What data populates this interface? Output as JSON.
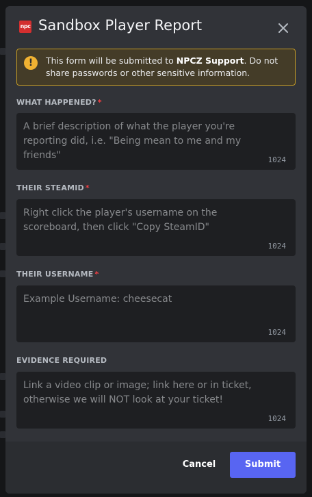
{
  "modal": {
    "app_icon_text": "npc",
    "title": "Sandbox Player Report",
    "close_icon": "close-icon"
  },
  "warning": {
    "icon": "warning-icon",
    "text_prefix": "This form will be submitted to ",
    "text_bold": "NPCZ Support",
    "text_suffix": ". Do not share passwords or other sensitive information."
  },
  "fields": [
    {
      "label": "WHAT HAPPENED?",
      "required": true,
      "required_mark": "*",
      "placeholder": "A brief description of what the player you're reporting did, i.e. \"Being mean to me and my friends\"",
      "value": "",
      "counter": "1024"
    },
    {
      "label": "THEIR STEAMID",
      "required": true,
      "required_mark": "*",
      "placeholder": "Right click the player's username on the scoreboard, then click \"Copy SteamID\"",
      "value": "",
      "counter": "1024"
    },
    {
      "label": "THEIR USERNAME",
      "required": true,
      "required_mark": "*",
      "placeholder": "Example Username: cheesecat",
      "value": "",
      "counter": "1024"
    },
    {
      "label": "EVIDENCE REQUIRED",
      "required": false,
      "required_mark": "",
      "placeholder": "Link a video clip or image; link here or in ticket, otherwise we will NOT look at your ticket!",
      "value": "",
      "counter": "1024"
    }
  ],
  "footer": {
    "cancel_label": "Cancel",
    "submit_label": "Submit"
  },
  "colors": {
    "modal_bg": "#313338",
    "footer_bg": "#2b2d31",
    "input_bg": "#1e1f22",
    "warning_bg": "#443c28",
    "warning_border": "#c49b25",
    "required": "#f23f43",
    "submit": "#5865f2"
  }
}
